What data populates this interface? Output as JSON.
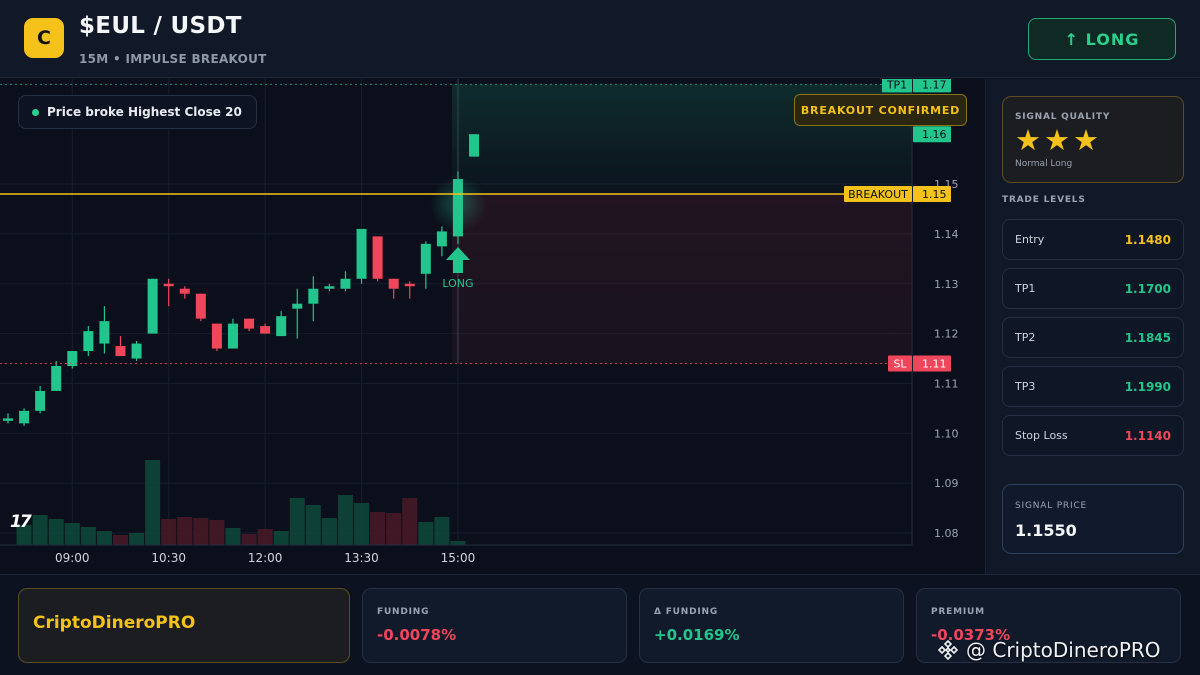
{
  "header": {
    "logo_letter": "C",
    "title": "$EUL / USDT",
    "subtitle": "15M • IMPULSE BREAKOUT",
    "action_label": "↑ LONG"
  },
  "chart": {
    "note": "Price broke Highest Close 20",
    "confirm_label": "BREAKOUT CONFIRMED",
    "tv_logo": "17",
    "signal_label": "LONG",
    "levels": {
      "tp1": {
        "label": "TP1",
        "price": 1.17,
        "text": "1.17"
      },
      "breakout": {
        "label": "BREAKOUT",
        "price": 1.148,
        "text": "1.15"
      },
      "sl": {
        "label": "SL",
        "price": 1.114,
        "text": "1.11"
      },
      "last": {
        "price": 1.16,
        "text": "1.16"
      }
    },
    "colors": {
      "up": "#22c58b",
      "down": "#f0465b",
      "breakout": "#f4c21a",
      "sl": "#f0465b",
      "tp": "#22c58b"
    }
  },
  "chart_data": {
    "type": "candlestick",
    "y_ticks": [
      "1.15",
      "1.14",
      "1.13",
      "1.12",
      "1.11",
      "1.10",
      "1.09",
      "1.08"
    ],
    "y_tick_values": [
      1.15,
      1.14,
      1.13,
      1.12,
      1.11,
      1.1,
      1.09,
      1.08
    ],
    "x_ticks": [
      "09:00",
      "10:30",
      "12:00",
      "13:30",
      "15:00"
    ],
    "x_tick_index": [
      4,
      10,
      16,
      22,
      28
    ],
    "candles": [
      {
        "o": 1.1025,
        "h": 1.104,
        "l": 1.102,
        "c": 1.103
      },
      {
        "o": 1.102,
        "h": 1.105,
        "l": 1.1015,
        "c": 1.1045
      },
      {
        "o": 1.1045,
        "h": 1.1095,
        "l": 1.104,
        "c": 1.1085
      },
      {
        "o": 1.1085,
        "h": 1.1145,
        "l": 1.1085,
        "c": 1.1135
      },
      {
        "o": 1.1135,
        "h": 1.1165,
        "l": 1.113,
        "c": 1.1165
      },
      {
        "o": 1.1165,
        "h": 1.1215,
        "l": 1.1155,
        "c": 1.1205
      },
      {
        "o": 1.118,
        "h": 1.1255,
        "l": 1.116,
        "c": 1.1225
      },
      {
        "o": 1.1175,
        "h": 1.1195,
        "l": 1.1155,
        "c": 1.1155
      },
      {
        "o": 1.115,
        "h": 1.1185,
        "l": 1.1145,
        "c": 1.118
      },
      {
        "o": 1.12,
        "h": 1.131,
        "l": 1.12,
        "c": 1.131
      },
      {
        "o": 1.13,
        "h": 1.131,
        "l": 1.1255,
        "c": 1.1295
      },
      {
        "o": 1.129,
        "h": 1.1295,
        "l": 1.127,
        "c": 1.128
      },
      {
        "o": 1.128,
        "h": 1.128,
        "l": 1.1225,
        "c": 1.123
      },
      {
        "o": 1.122,
        "h": 1.122,
        "l": 1.1165,
        "c": 1.117
      },
      {
        "o": 1.117,
        "h": 1.123,
        "l": 1.117,
        "c": 1.122
      },
      {
        "o": 1.123,
        "h": 1.123,
        "l": 1.1205,
        "c": 1.121
      },
      {
        "o": 1.1215,
        "h": 1.122,
        "l": 1.12,
        "c": 1.12
      },
      {
        "o": 1.1195,
        "h": 1.1245,
        "l": 1.1195,
        "c": 1.1235
      },
      {
        "o": 1.125,
        "h": 1.129,
        "l": 1.119,
        "c": 1.126
      },
      {
        "o": 1.126,
        "h": 1.1315,
        "l": 1.1225,
        "c": 1.129
      },
      {
        "o": 1.129,
        "h": 1.13,
        "l": 1.1285,
        "c": 1.1295
      },
      {
        "o": 1.129,
        "h": 1.1325,
        "l": 1.1285,
        "c": 1.131
      },
      {
        "o": 1.131,
        "h": 1.141,
        "l": 1.13,
        "c": 1.141
      },
      {
        "o": 1.1395,
        "h": 1.1395,
        "l": 1.1305,
        "c": 1.131
      },
      {
        "o": 1.131,
        "h": 1.131,
        "l": 1.127,
        "c": 1.129
      },
      {
        "o": 1.13,
        "h": 1.1305,
        "l": 1.127,
        "c": 1.1295
      },
      {
        "o": 1.132,
        "h": 1.1385,
        "l": 1.129,
        "c": 1.138
      },
      {
        "o": 1.1375,
        "h": 1.1415,
        "l": 1.1355,
        "c": 1.1405
      },
      {
        "o": 1.1395,
        "h": 1.1525,
        "l": 1.138,
        "c": 1.151
      },
      {
        "o": 1.1555,
        "h": 1.16,
        "l": 1.1555,
        "c": 1.16
      }
    ],
    "volume": [
      0,
      20,
      30,
      26,
      22,
      18,
      14,
      10,
      12,
      85,
      26,
      28,
      27,
      25,
      17,
      11,
      16,
      14,
      47,
      40,
      27,
      50,
      42,
      33,
      32,
      47,
      23,
      28,
      4,
      0
    ]
  },
  "sidebar": {
    "quality_label": "SIGNAL QUALITY",
    "stars": "★★★",
    "quality_sub": "Normal Long",
    "levels_title": "TRADE LEVELS",
    "levels": [
      {
        "name": "Entry",
        "value": "1.1480",
        "color": "#f4c21a"
      },
      {
        "name": "TP1",
        "value": "1.1700",
        "color": "#22c58b"
      },
      {
        "name": "TP2",
        "value": "1.1845",
        "color": "#22c58b"
      },
      {
        "name": "TP3",
        "value": "1.1990",
        "color": "#22c58b"
      },
      {
        "name": "Stop Loss",
        "value": "1.1140",
        "color": "#f0465b"
      }
    ],
    "signal_price_label": "SIGNAL PRICE",
    "signal_price": "1.1550"
  },
  "footer": {
    "brand": "CriptoDineroPRO",
    "metrics": [
      {
        "label": "FUNDING",
        "value": "-0.0078%",
        "color": "#f0465b"
      },
      {
        "label": "Δ FUNDING",
        "value": "+0.0169%",
        "color": "#22c58b"
      },
      {
        "label": "PREMIUM",
        "value": "-0.0373%",
        "color": "#f0465b"
      }
    ],
    "watermark": "@ CriptoDineroPRO"
  }
}
